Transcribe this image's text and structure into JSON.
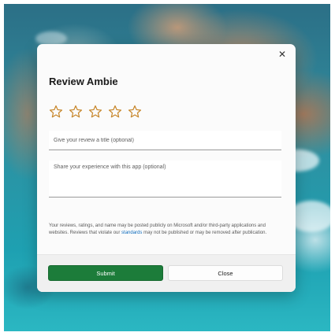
{
  "dialog": {
    "title": "Review Ambie",
    "close_glyph": "✕",
    "rating": {
      "max": 5,
      "selected": 0,
      "star_color": "#c7862a"
    },
    "review_title": {
      "value": "",
      "placeholder": "Give your review a title (optional)"
    },
    "review_body": {
      "value": "",
      "placeholder": "Share your experience with this app (optional)"
    },
    "disclaimer": {
      "before": "Your reviews, ratings, and name may be posted publicly on Microsoft and/or third-party applications and websites. Reviews that violate our ",
      "link_text": "standards",
      "after": " may not be published or may be removed after publication."
    },
    "submit_label": "Submit",
    "close_label": "Close",
    "accent_color": "#1c7c3a",
    "link_color": "#0f6cbd"
  }
}
